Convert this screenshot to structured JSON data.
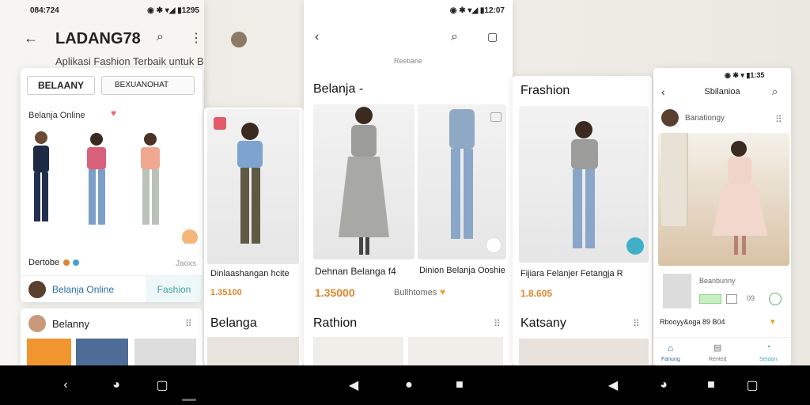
{
  "left_phone": {
    "status_time": "084:724",
    "status_right": "1295",
    "title": "LADANG78",
    "subtitle": "Aplikasi Fashion Terbaik untuk Belanja Online",
    "tabs": [
      "BELAANY",
      "BEXUANOHAT"
    ],
    "section": "Belanja Online",
    "count_label": "Dertobe",
    "side_label": "Jaoxs",
    "footer_left": "Belanja Online",
    "footer_right": "Fashion",
    "list_title": "Belanny"
  },
  "phone2": {
    "product_label": "Dinlaashangan hcite",
    "price": "1.35100",
    "section": "Belanga"
  },
  "phone3": {
    "status_right": "12:07",
    "header_small": "Reetiane",
    "section": "Belanja -",
    "item1_label": "Dehnan Belanga f4",
    "item1_price": "1.35000",
    "item2_label": "Dinion Belanja Ooshie",
    "item2_meta": "Bullhtomes",
    "lower_section": "Rathion"
  },
  "phone4": {
    "section": "Frashion",
    "item_label": "Fijiara Felanjer Fetangja R",
    "item_price": "1.8.605",
    "lower_section": "Katsany"
  },
  "phone5": {
    "status_right": "1:35",
    "title": "Sbilanioa",
    "profile_label": "Banationgy",
    "row_label": "Beanbunny",
    "row_counts": "09",
    "footer_text": "Rbooyy&oga 89 B04",
    "tabs": [
      "Fanung",
      "Rented",
      "Setaan"
    ]
  },
  "colors": {
    "accent_orange": "#e0862b",
    "accent_teal": "#3fb0c7",
    "nav_bg": "#000000"
  }
}
